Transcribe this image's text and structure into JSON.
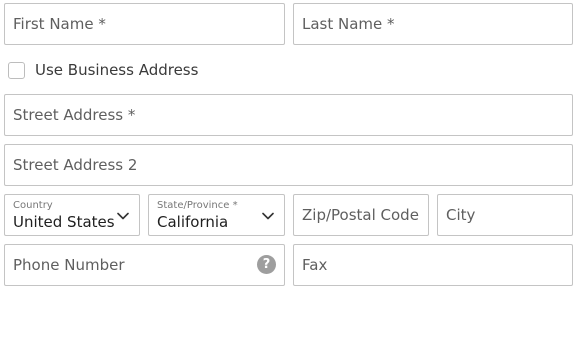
{
  "form": {
    "first_name": {
      "placeholder": "First Name *",
      "value": ""
    },
    "last_name": {
      "placeholder": "Last Name *",
      "value": ""
    },
    "use_business_address": {
      "label": "Use Business Address",
      "checked": false
    },
    "street_address": {
      "placeholder": "Street Address *",
      "value": ""
    },
    "street_address_2": {
      "placeholder": "Street Address 2",
      "value": ""
    },
    "country": {
      "label": "Country",
      "value": "United States",
      "icon": "chevron-down-icon"
    },
    "state": {
      "label": "State/Province *",
      "value": "California",
      "icon": "chevron-down-icon"
    },
    "zip": {
      "placeholder": "Zip/Postal Code",
      "value": ""
    },
    "city": {
      "placeholder": "City",
      "value": ""
    },
    "phone": {
      "placeholder": "Phone Number",
      "value": "",
      "help_icon": "?"
    },
    "fax": {
      "placeholder": "Fax",
      "value": ""
    }
  },
  "colors": {
    "border": "#c4c4c4",
    "placeholder": "#5f5f5f",
    "help_icon_bg": "#9e9e9e"
  }
}
